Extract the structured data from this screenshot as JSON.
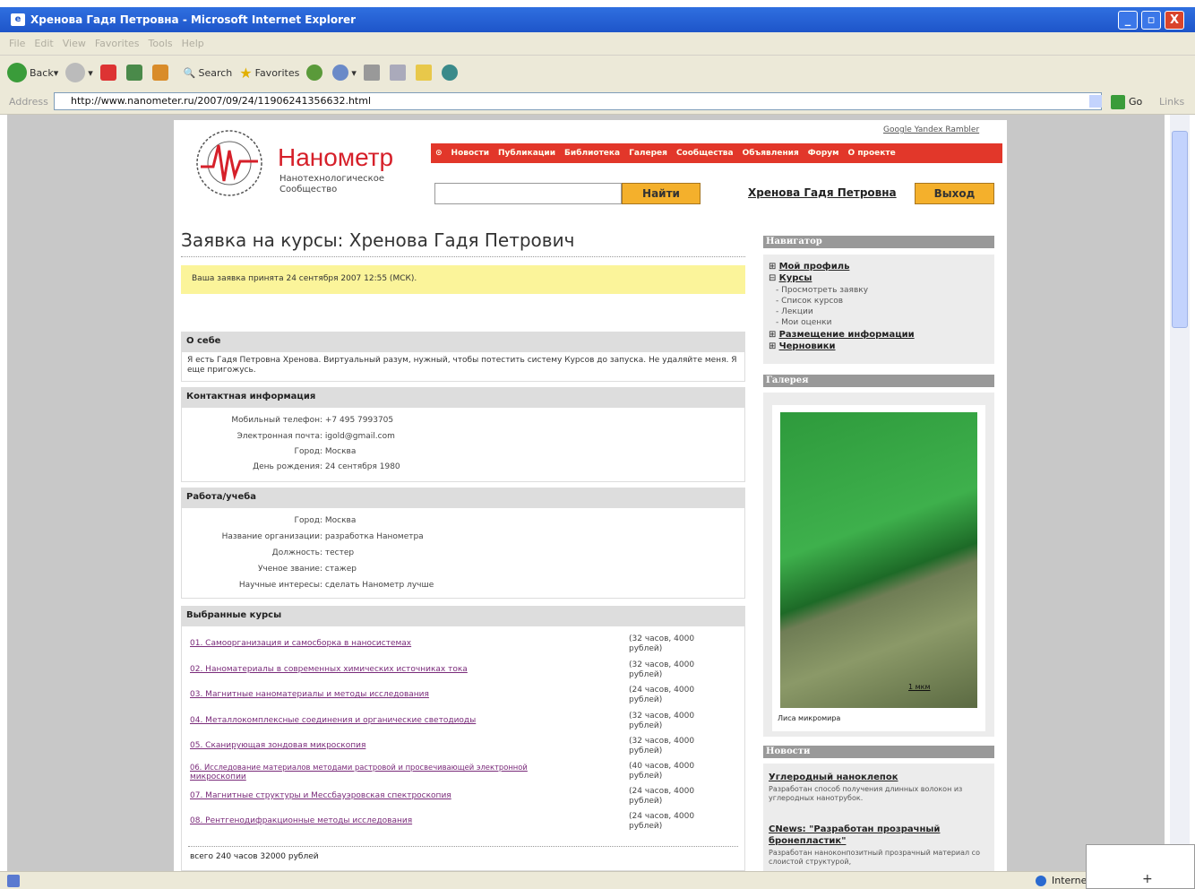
{
  "window": {
    "title": "Хренова Гадя Петровна - Microsoft Internet Explorer",
    "min": "_",
    "max": "▫",
    "close": "X"
  },
  "menu": [
    "File",
    "Edit",
    "View",
    "Favorites",
    "Tools",
    "Help"
  ],
  "toolbar": {
    "back": "Back",
    "search": "Search",
    "favorites": "Favorites"
  },
  "address": {
    "label": "Address",
    "url": "http://www.nanometer.ru/2007/09/24/11906241356632.html",
    "go": "Go",
    "links": "Links"
  },
  "site": {
    "logo_title": "Нанометр",
    "logo_sub": "Нанотехнологическое Сообщество",
    "toplinks": "Google Yandex Rambler",
    "nav": [
      "Новости",
      "Публикации",
      "Библиотека",
      "Галерея",
      "Сообщества",
      "Объявления",
      "Форум",
      "О проекте"
    ],
    "search_button": "Найти",
    "user_link": "Хренова Гадя Петровна",
    "logout": "Выход"
  },
  "main": {
    "title": "Заявка на курсы: Хренова Гадя Петрович",
    "notice": "Ваша заявка принята 24 сентября 2007 12:55 (МСК).",
    "about_head": "О себе",
    "about_text": "Я есть Гадя Петровна Хренова. Виртуальный разум, нужный, чтобы потестить систему Курсов до запуска. Не удаляйте меня. Я еще пригожусь.",
    "contact_head": "Контактная информация",
    "contact": [
      {
        "k": "Мобильный телефон:",
        "v": "+7 495 7993705"
      },
      {
        "k": "Электронная почта:",
        "v": "igold@gmail.com"
      },
      {
        "k": "Город:",
        "v": "Москва"
      },
      {
        "k": "День рождения:",
        "v": "24 сентября 1980"
      }
    ],
    "work_head": "Работа/учеба",
    "work": [
      {
        "k": "Город:",
        "v": "Москва"
      },
      {
        "k": "Название организации:",
        "v": "разработка Нанометра"
      },
      {
        "k": "Должность:",
        "v": "тестер"
      },
      {
        "k": "Ученое звание:",
        "v": "стажер"
      },
      {
        "k": "Научные интересы:",
        "v": "сделать Нанометр лучше"
      }
    ],
    "courses_head": "Выбранные курсы",
    "courses": [
      {
        "name": "01. Самоорганизация и самосборка в наносистемах",
        "dur": "(32 часов, 4000 рублей)"
      },
      {
        "name": "02. Наноматериалы в современных химических источниках тока",
        "dur": "(32 часов, 4000 рублей)"
      },
      {
        "name": "03. Магнитные наноматериалы и методы исследования",
        "dur": "(24 часов, 4000 рублей)"
      },
      {
        "name": "04. Металлокомплексные соединения и органические светодиоды",
        "dur": "(32 часов, 4000 рублей)"
      },
      {
        "name": "05. Сканирующая зондовая микроскопия",
        "dur": "(32 часов, 4000 рублей)"
      },
      {
        "name": "06. Исследование материалов методами растровой и просвечивающей электронной",
        "name2": "микроскопии",
        "dur": "(40 часов, 4000 рублей)"
      },
      {
        "name": "07. Магнитные структуры и Мессбауэровская спектроскопия",
        "dur": "(24 часов, 4000 рублей)"
      },
      {
        "name": "08. Рентгенодифракционные методы исследования",
        "dur": "(24 часов, 4000 рублей)"
      }
    ],
    "total": "всего 240 часов 32000 рублей"
  },
  "sidebar": {
    "nav_head": "Навигатор",
    "nav": [
      "Мой профиль",
      "Курсы",
      "Размещение информации",
      "Черновики"
    ],
    "sub": [
      "- Просмотреть заявку",
      "- Список курсов",
      "- Лекции",
      "- Мои оценки"
    ],
    "gallery_head": "Галерея",
    "photo_caption": "Лиса микромира",
    "scale": "1 мкм",
    "news_head": "Новости",
    "news": [
      {
        "t": "Углеродный наноклепок",
        "d": "Разработан способ получения длинных волокон из углеродных нанотрубок."
      },
      {
        "t": "CNews: \"Разработан прозрачный",
        "t2": "бронепластик\"",
        "d": "Разработан наноконпозитный прозрачный материал со слоистой структурой,"
      }
    ]
  },
  "status": {
    "zone": "Internet"
  }
}
